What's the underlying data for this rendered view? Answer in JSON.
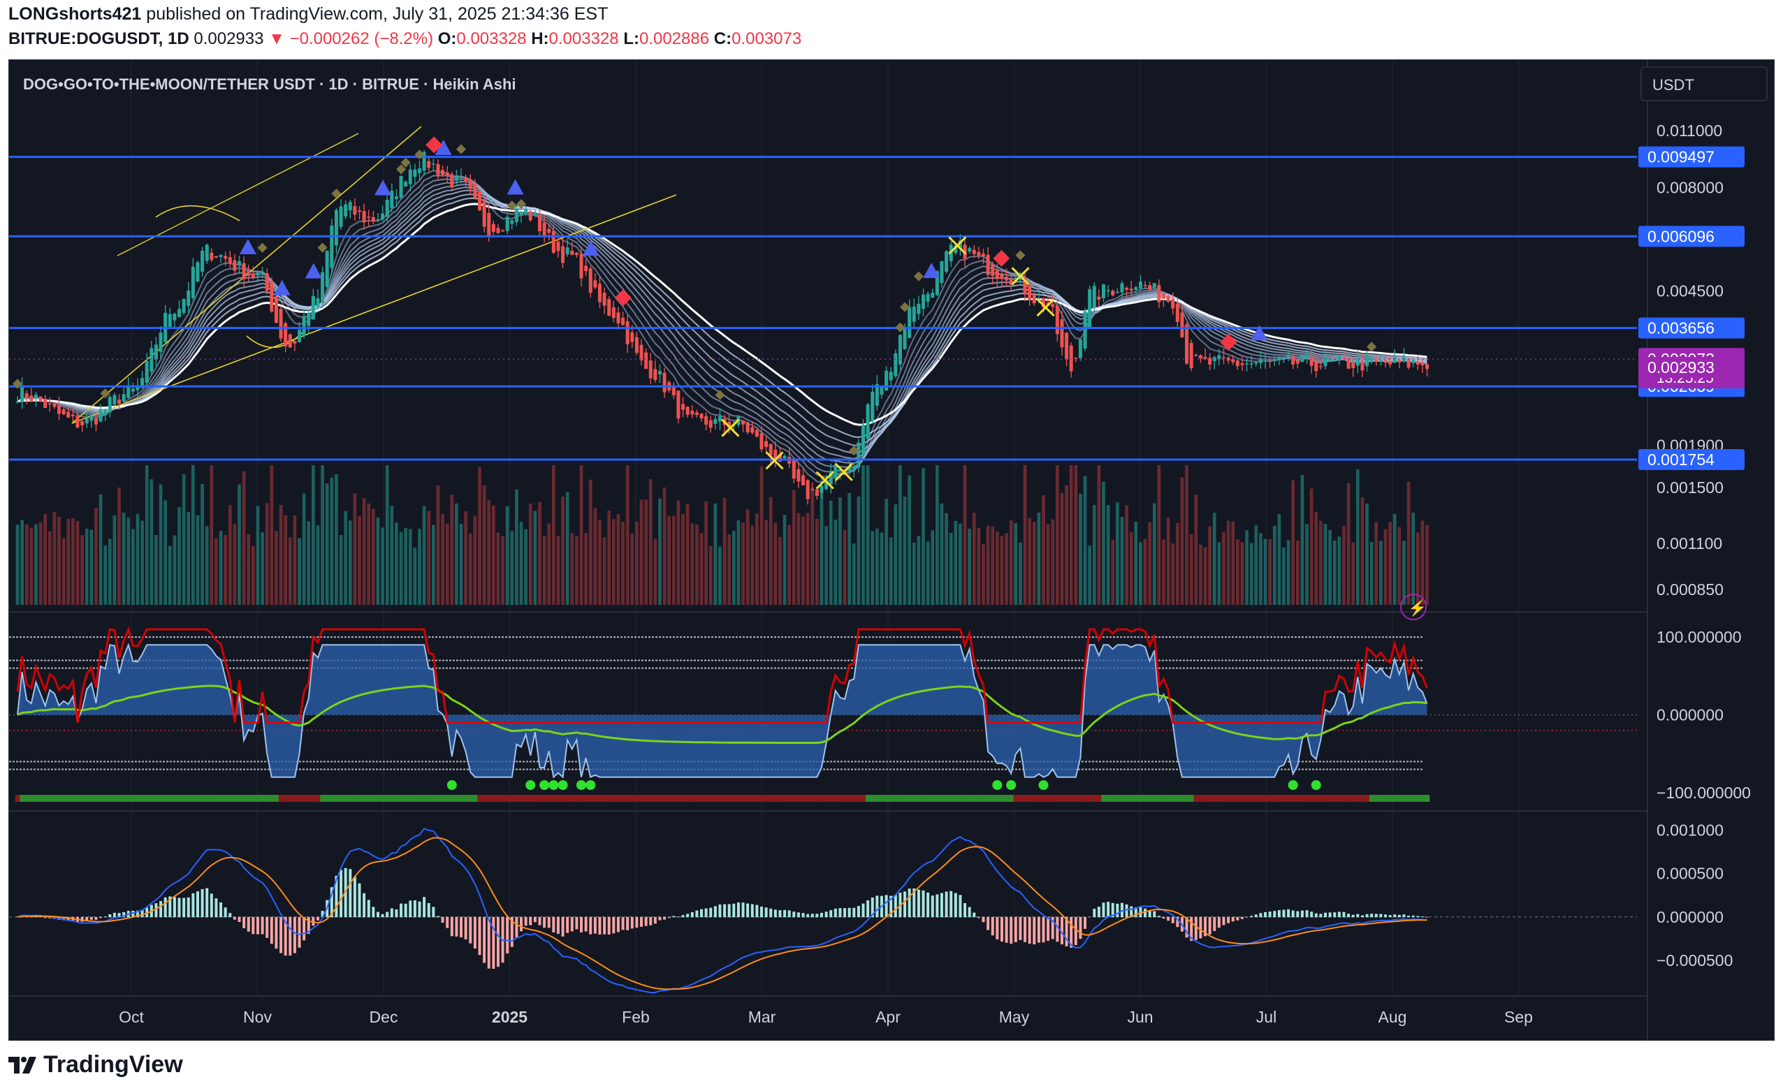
{
  "header": {
    "publisher": "LONGshorts421",
    "published_text": "published on TradingView.com, July 31, 2025 21:34:36 EST",
    "symbol": "BITRUE:DOGUSDT, 1D",
    "last": "0.002933",
    "change": "−0.000262 (−8.2%)",
    "o_label": "O:",
    "o": "0.003328",
    "h_label": "H:",
    "h": "0.003328",
    "l_label": "L:",
    "l": "0.002886",
    "c_label": "C:",
    "c": "0.003073"
  },
  "legend_title": "DOG•GO•TO•THE•MOON/TETHER USDT · 1D · BITRUE · Heikin Ashi",
  "currency_button": "USDT",
  "footer": {
    "brand": "TradingView"
  },
  "colors": {
    "bg": "#131722",
    "up": "#26a69a",
    "down": "#ef5350",
    "level": "#2962ff",
    "grid": "#1e222d",
    "axis_text": "#d1d4dc",
    "price_tag": "#9c27b0"
  },
  "chart_data": {
    "type": "candlestick",
    "scale": "log",
    "x_ticks": [
      "Oct",
      "Nov",
      "Dec",
      "2025",
      "Feb",
      "Mar",
      "Apr",
      "May",
      "Jun",
      "Jul",
      "Aug",
      "Sep"
    ],
    "y_ticks": [
      "0.011000",
      "0.008000",
      "0.004500",
      "0.001900",
      "0.001500",
      "0.001100",
      "0.000850"
    ],
    "ylim": [
      0.00078,
      0.0128
    ],
    "horizontal_levels": [
      {
        "label": "0.009497",
        "value": 0.009497
      },
      {
        "label": "0.006096",
        "value": 0.006096
      },
      {
        "label": "0.003656",
        "value": 0.003656
      },
      {
        "label": "0.002639",
        "value": 0.002639
      },
      {
        "label": "0.001754",
        "value": 0.001754
      }
    ],
    "current_price": {
      "label": "0.003073",
      "value": 0.003073,
      "countdown": "13:25:25"
    },
    "last_price_tag": {
      "label": "0.002933",
      "value": 0.002933
    },
    "price_path_anchors": [
      {
        "month": 0.0,
        "price": 0.00255
      },
      {
        "month": 0.5,
        "price": 0.00215
      },
      {
        "month": 0.9,
        "price": 0.00255
      },
      {
        "month": 1.25,
        "price": 0.0041
      },
      {
        "month": 1.5,
        "price": 0.0056
      },
      {
        "month": 1.9,
        "price": 0.0049
      },
      {
        "month": 2.15,
        "price": 0.0033
      },
      {
        "month": 2.35,
        "price": 0.0042
      },
      {
        "month": 2.55,
        "price": 0.0072
      },
      {
        "month": 2.8,
        "price": 0.0067
      },
      {
        "month": 3.2,
        "price": 0.0093
      },
      {
        "month": 3.5,
        "price": 0.0082
      },
      {
        "month": 3.75,
        "price": 0.0064
      },
      {
        "month": 4.0,
        "price": 0.007
      },
      {
        "month": 4.35,
        "price": 0.0055
      },
      {
        "month": 4.7,
        "price": 0.004
      },
      {
        "month": 5.0,
        "price": 0.0029
      },
      {
        "month": 5.35,
        "price": 0.00215
      },
      {
        "month": 5.7,
        "price": 0.00215
      },
      {
        "month": 6.0,
        "price": 0.0018
      },
      {
        "month": 6.25,
        "price": 0.00145
      },
      {
        "month": 6.6,
        "price": 0.0017
      },
      {
        "month": 6.8,
        "price": 0.0026
      },
      {
        "month": 7.15,
        "price": 0.0043
      },
      {
        "month": 7.45,
        "price": 0.0057
      },
      {
        "month": 7.8,
        "price": 0.005
      },
      {
        "month": 8.15,
        "price": 0.0042
      },
      {
        "month": 8.35,
        "price": 0.0029
      },
      {
        "month": 8.5,
        "price": 0.0044
      },
      {
        "month": 8.85,
        "price": 0.0047
      },
      {
        "month": 9.15,
        "price": 0.0043
      },
      {
        "month": 9.3,
        "price": 0.003
      }
    ],
    "oscillator": {
      "y_ticks": [
        "100.000000",
        "0.000000",
        "−100.000000"
      ],
      "ylim": [
        -110,
        110
      ]
    },
    "macd": {
      "y_ticks": [
        "0.001000",
        "0.000500",
        "0.000000",
        "−0.000500"
      ],
      "ylim": [
        -0.00075,
        0.0011
      ]
    }
  }
}
